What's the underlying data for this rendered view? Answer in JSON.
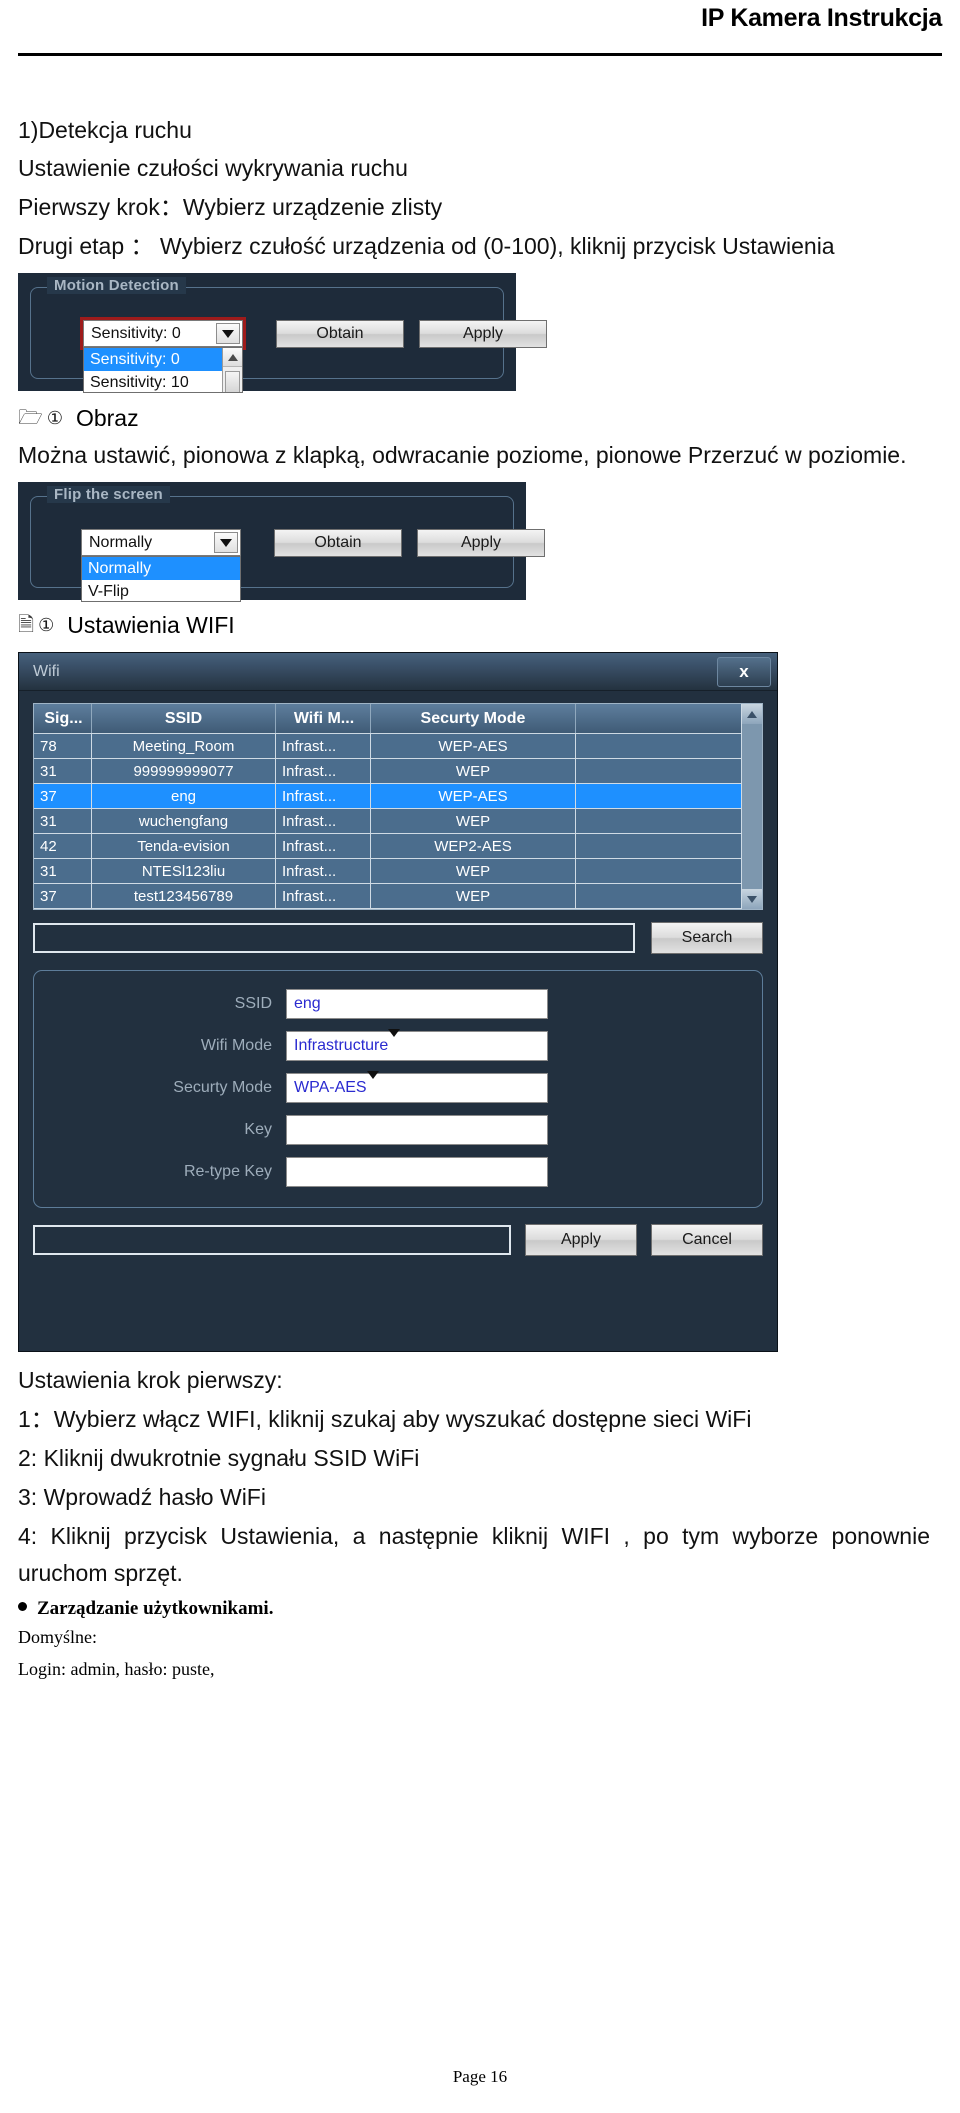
{
  "document": {
    "header_title": "IP Kamera Instrukcja",
    "page_footer": "Page 16"
  },
  "section_motion": {
    "heading": "1)Detekcja ruchu",
    "line1": "Ustawienie czułości wykrywania ruchu",
    "line2": "Pierwszy krok：Wybierz urządzenie zlisty",
    "line3": "Drugi  etap  ：  Wybierz  czułość  urządzenia  od  (0-100),  kliknij  przycisk Ustawienia"
  },
  "motion_panel": {
    "group_title": "Motion Detection",
    "combo_value": "Sensitivity: 0",
    "dropdown_options": [
      "Sensitivity: 0",
      "Sensitivity: 10"
    ],
    "obtain_label": "Obtain",
    "apply_label": "Apply"
  },
  "section_image": {
    "folder_icon": "folder-icon",
    "circle_icon": "circled-one-icon",
    "heading": "Obraz",
    "line1": "Można ustawić, pionowa z klapką, odwracanie poziome, pionowe Przerzuć w poziomie."
  },
  "flip_panel": {
    "group_title": "Flip the screen",
    "combo_value": "Normally",
    "dropdown_options": [
      "Normally",
      "V-Flip"
    ],
    "obtain_label": "Obtain",
    "apply_label": "Apply"
  },
  "section_wifi": {
    "doc_icon": "document-icon",
    "circle_icon": "circled-one-icon",
    "heading": "Ustawienia WIFI"
  },
  "wifi_dialog": {
    "title": "Wifi",
    "close_label": "x",
    "table": {
      "columns": [
        "Sig...",
        "SSID",
        "Wifi M...",
        "Securty Mode",
        ""
      ],
      "rows": [
        {
          "sig": "78",
          "ssid": "Meeting_Room",
          "mode": "Infrast...",
          "security": "WEP-AES",
          "selected": false
        },
        {
          "sig": "31",
          "ssid": "999999999077",
          "mode": "Infrast...",
          "security": "WEP",
          "selected": false
        },
        {
          "sig": "37",
          "ssid": "eng",
          "mode": "Infrast...",
          "security": "WEP-AES",
          "selected": true
        },
        {
          "sig": "31",
          "ssid": "wuchengfang",
          "mode": "Infrast...",
          "security": "WEP",
          "selected": false
        },
        {
          "sig": "42",
          "ssid": "Tenda-evision",
          "mode": "Infrast...",
          "security": "WEP2-AES",
          "selected": false
        },
        {
          "sig": "31",
          "ssid": "NTESl123liu",
          "mode": "Infrast...",
          "security": "WEP",
          "selected": false
        },
        {
          "sig": "37",
          "ssid": "test123456789",
          "mode": "Infrast...",
          "security": "WEP",
          "selected": false
        }
      ]
    },
    "search_value": "",
    "search_label": "Search",
    "form": {
      "ssid_label": "SSID",
      "ssid_value": "eng",
      "wifi_mode_label": "Wifi Mode",
      "wifi_mode_value": "Infrastructure",
      "security_mode_label": "Securty Mode",
      "security_mode_value": "WPA-AES",
      "key_label": "Key",
      "key_value": "",
      "retype_key_label": "Re-type Key",
      "retype_key_value": ""
    },
    "status_value": "",
    "apply_label": "Apply",
    "cancel_label": "Cancel"
  },
  "instructions": {
    "title": "Ustawienia krok pierwszy:",
    "steps": [
      "1：Wybierz włącz WIFI, kliknij szukaj aby wyszukać dostępne sieci WiFi",
      "2: Kliknij dwukrotnie sygnału SSID WiFi",
      "3: Wprowadź hasło WiFi",
      "4:  Kliknij  przycisk  Ustawienia,  a  następnie  kliknij  WIFI ,  po  tym  wyborze ponownie uruchom sprzęt."
    ],
    "bullet": "Zarządzanie użytkownikami.",
    "default_label": "Domyślne:",
    "login_line": "Login: admin, hasło: puste,"
  }
}
